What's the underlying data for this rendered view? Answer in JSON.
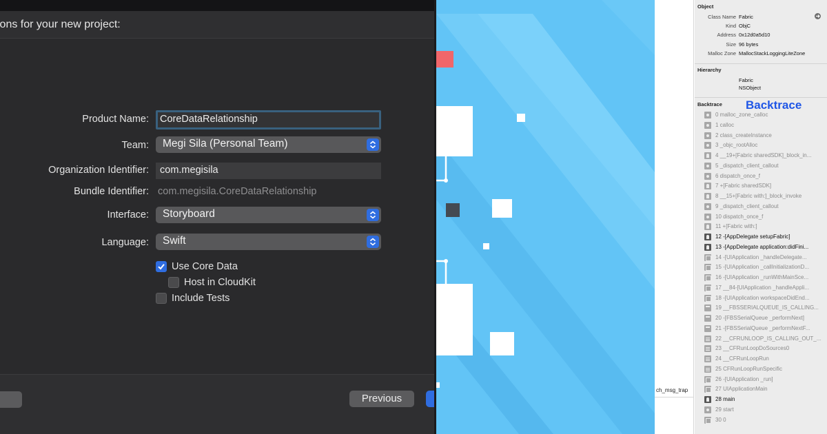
{
  "xcode_sheet": {
    "heading": "ions for your new project:",
    "product_name_label": "Product Name:",
    "product_name_value": "CoreDataRelationship",
    "team_label": "Team:",
    "team_value": "Megi Sila (Personal Team)",
    "org_id_label": "Organization Identifier:",
    "org_id_value": "com.megisila",
    "bundle_id_label": "Bundle Identifier:",
    "bundle_id_value": "com.megisila.CoreDataRelationship",
    "interface_label": "Interface:",
    "interface_value": "Storyboard",
    "language_label": "Language:",
    "language_value": "Swift",
    "use_core_data_label": "Use Core Data",
    "use_core_data_checked": true,
    "host_in_cloudkit_label": "Host in CloudKit",
    "host_in_cloudkit_checked": false,
    "include_tests_label": "Include Tests",
    "include_tests_checked": false,
    "previous_button": "Previous"
  },
  "memory_inspector": {
    "trap_label": "ch_msg_trap",
    "object_section": "Object",
    "class_name_key": "Class Name",
    "class_name_val": "Fabric",
    "kind_key": "Kind",
    "kind_val": "ObjC",
    "address_key": "Address",
    "address_val": "0x12d0a5d10",
    "size_key": "Size",
    "size_val": "96 bytes",
    "malloc_zone_key": "Malloc Zone",
    "malloc_zone_val": "MallocStackLoggingLiteZone",
    "hierarchy_section": "Hierarchy",
    "hierarchy": [
      "Fabric",
      "NSObject"
    ],
    "backtrace_section": "Backtrace",
    "backtrace_annotation": "Backtrace",
    "frames": [
      {
        "text": "0 malloc_zone_calloc",
        "bold": false,
        "icon": "gear"
      },
      {
        "text": "1 calloc",
        "bold": false,
        "icon": "gear"
      },
      {
        "text": "2 class_createInstance",
        "bold": false,
        "icon": "gear"
      },
      {
        "text": "3 _objc_rootAlloc",
        "bold": false,
        "icon": "gear"
      },
      {
        "text": "4 __19+[Fabric sharedSDK]_block_in...",
        "bold": false,
        "icon": "user"
      },
      {
        "text": "5 _dispatch_client_callout",
        "bold": false,
        "icon": "gear"
      },
      {
        "text": "6 dispatch_once_f",
        "bold": false,
        "icon": "gear"
      },
      {
        "text": "7 +[Fabric sharedSDK]",
        "bold": false,
        "icon": "user"
      },
      {
        "text": "8 __15+[Fabric with:]_block_invoke",
        "bold": false,
        "icon": "user"
      },
      {
        "text": "9 _dispatch_client_callout",
        "bold": false,
        "icon": "gear"
      },
      {
        "text": "10 dispatch_once_f",
        "bold": false,
        "icon": "gear"
      },
      {
        "text": "11 +[Fabric with:]",
        "bold": false,
        "icon": "user"
      },
      {
        "text": "12 -[AppDelegate setupFabric]",
        "bold": true,
        "icon": "user"
      },
      {
        "text": "13 -[AppDelegate application:didFini...",
        "bold": true,
        "icon": "user"
      },
      {
        "text": "14 -[UIApplication _handleDelegate...",
        "bold": false,
        "icon": "box"
      },
      {
        "text": "15 -[UIApplication _callInitializationD...",
        "bold": false,
        "icon": "box"
      },
      {
        "text": "16 -[UIApplication _runWithMainSce...",
        "bold": false,
        "icon": "box"
      },
      {
        "text": "17 __84-[UIApplication _handleAppli...",
        "bold": false,
        "icon": "box"
      },
      {
        "text": "18 -[UIApplication workspaceDidEnd...",
        "bold": false,
        "icon": "box"
      },
      {
        "text": "19 __FBSSERIALQUEUE_IS_CALLING...",
        "bold": false,
        "icon": "win"
      },
      {
        "text": "20 -[FBSSerialQueue _performNext]",
        "bold": false,
        "icon": "win"
      },
      {
        "text": "21 -[FBSSerialQueue _performNextF...",
        "bold": false,
        "icon": "win"
      },
      {
        "text": "22 __CFRUNLOOP_IS_CALLING_OUT_...",
        "bold": false,
        "icon": "lines"
      },
      {
        "text": "23 __CFRunLoopDoSources0",
        "bold": false,
        "icon": "lines"
      },
      {
        "text": "24 __CFRunLoopRun",
        "bold": false,
        "icon": "lines"
      },
      {
        "text": "25 CFRunLoopRunSpecific",
        "bold": false,
        "icon": "lines"
      },
      {
        "text": "26 -[UIApplication _run]",
        "bold": false,
        "icon": "box"
      },
      {
        "text": "27 UIApplicationMain",
        "bold": false,
        "icon": "box"
      },
      {
        "text": "28 main",
        "bold": true,
        "icon": "user"
      },
      {
        "text": "29 start",
        "bold": false,
        "icon": "gear"
      },
      {
        "text": "30 0",
        "bold": false,
        "icon": "box"
      }
    ]
  },
  "colors": {
    "accent_blue": "#2f6de0",
    "game_sky": "#62c4f6",
    "annotation_blue": "#1f56e6",
    "game_red": "#f0666a"
  }
}
